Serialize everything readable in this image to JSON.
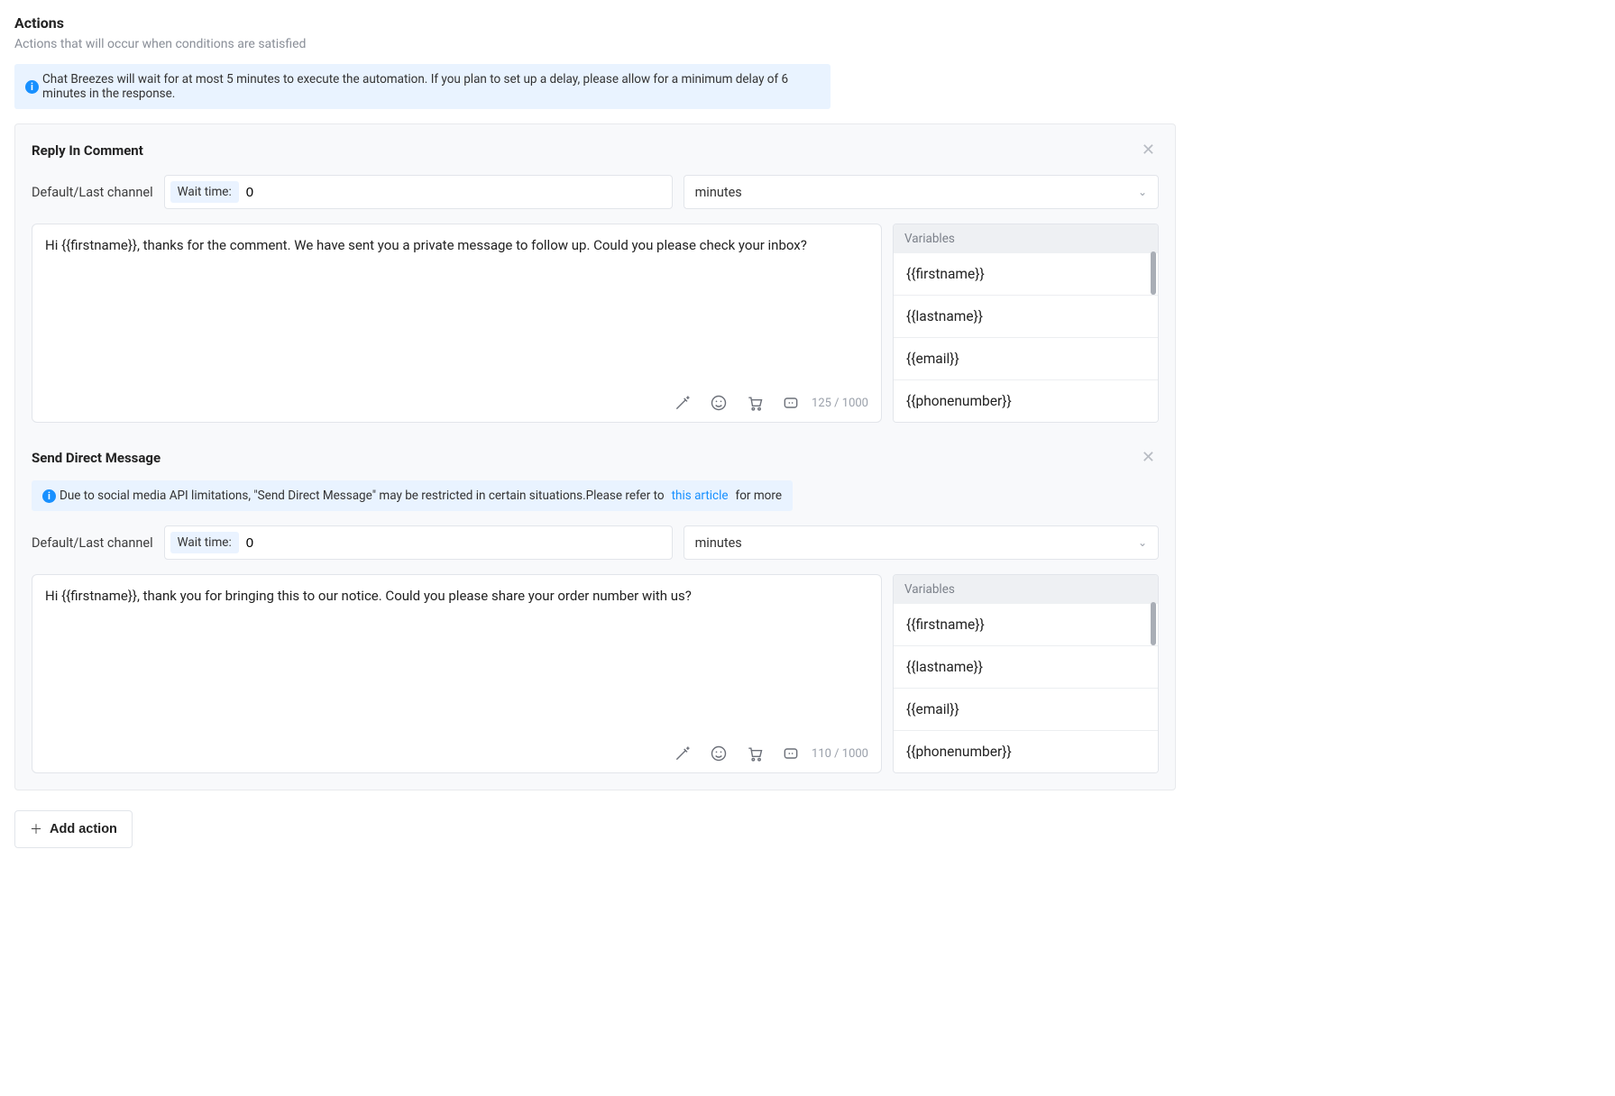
{
  "section": {
    "title": "Actions",
    "subtitle": "Actions that will occur when conditions are satisfied",
    "top_alert": "Chat Breezes will wait for at most 5 minutes to execute the automation. If you plan to set up a delay, please allow for a minimum delay of 6 minutes in the response."
  },
  "common": {
    "channel_label": "Default/Last channel",
    "wait_label": "Wait time:",
    "unit_value": "minutes",
    "variables_header": "Variables",
    "variables": [
      "{{firstname}}",
      "{{lastname}}",
      "{{email}}",
      "{{phonenumber}}"
    ],
    "add_action_label": "Add action"
  },
  "actions": [
    {
      "title": "Reply In Comment",
      "wait_value": "0",
      "body": "Hi {{firstname}}, thanks for the comment. We have sent you a private message to follow up. Could you please check your inbox?",
      "char_count": "125 / 1000"
    },
    {
      "title": "Send Direct Message",
      "alert_prefix": "Due to social media API limitations, \"Send Direct Message\" may be restricted in certain situations.Please refer to",
      "alert_link": "this article",
      "alert_suffix": "for more",
      "wait_value": "0",
      "body": "Hi {{firstname}}, thank you for bringing this to our notice. Could you please share your order number with us?",
      "char_count": "110 / 1000"
    }
  ]
}
